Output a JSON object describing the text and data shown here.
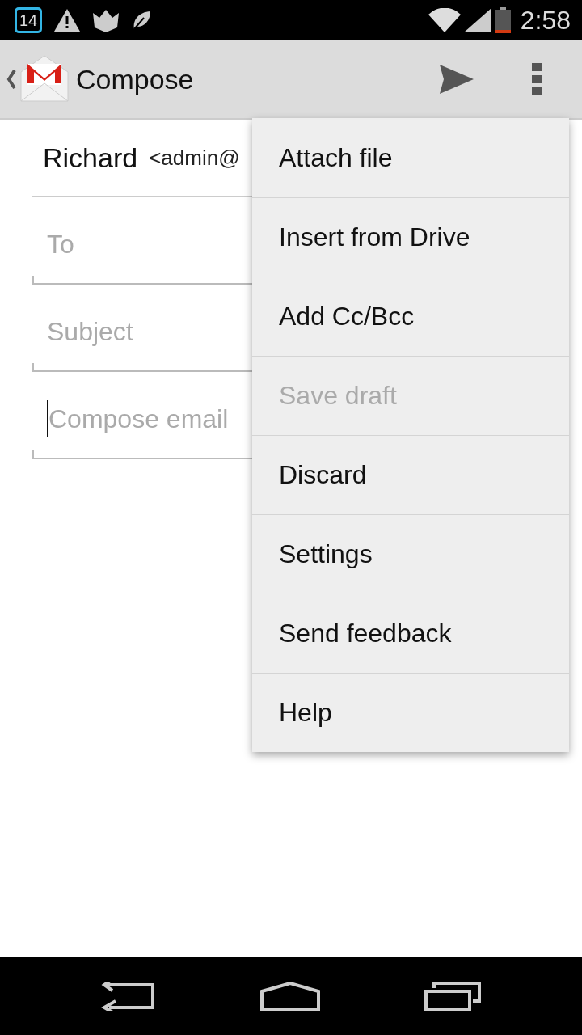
{
  "status_bar": {
    "calendar_day": "14",
    "time": "2:58"
  },
  "action_bar": {
    "title": "Compose"
  },
  "from": {
    "name": "Richard",
    "address": "<admin@"
  },
  "fields": [
    {
      "placeholder": "To",
      "cursor": false
    },
    {
      "placeholder": "Subject",
      "cursor": false
    },
    {
      "placeholder": "Compose email",
      "cursor": true
    }
  ],
  "menu": [
    {
      "label": "Attach file",
      "disabled": false
    },
    {
      "label": "Insert from Drive",
      "disabled": false
    },
    {
      "label": "Add Cc/Bcc",
      "disabled": false
    },
    {
      "label": "Save draft",
      "disabled": true
    },
    {
      "label": "Discard",
      "disabled": false
    },
    {
      "label": "Settings",
      "disabled": false
    },
    {
      "label": "Send feedback",
      "disabled": false
    },
    {
      "label": "Help",
      "disabled": false
    }
  ]
}
